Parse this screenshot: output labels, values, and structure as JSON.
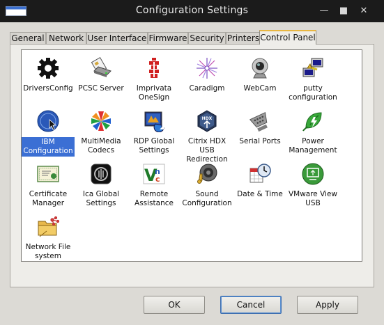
{
  "window": {
    "title": "Configuration Settings"
  },
  "tabs": [
    "General",
    "Network",
    "User Interface",
    "Firmware",
    "Security",
    "Printers",
    "Control Panel"
  ],
  "active_tab": "Control Panel",
  "items": [
    {
      "label": "DriversConfig",
      "icon": "gear-icon"
    },
    {
      "label": "PCSC Server",
      "icon": "card-reader-icon"
    },
    {
      "label": "Imprivata OneSign",
      "icon": "imprivata-icon"
    },
    {
      "label": "Caradigm",
      "icon": "caradigm-icon"
    },
    {
      "label": "WebCam",
      "icon": "webcam-icon"
    },
    {
      "label": "putty configuration",
      "icon": "putty-icon"
    },
    {
      "label": "IBM Configuration",
      "icon": "ibm-icon",
      "selected": true
    },
    {
      "label": "MultiMedia Codecs",
      "icon": "multimedia-icon"
    },
    {
      "label": "RDP Global Settings",
      "icon": "rdp-icon"
    },
    {
      "label": "Citrix HDX USB Redirection",
      "icon": "citrix-hdx-icon"
    },
    {
      "label": "Serial Ports",
      "icon": "serial-port-icon"
    },
    {
      "label": "Power Management",
      "icon": "power-icon"
    },
    {
      "label": "Certificate Manager",
      "icon": "certificate-icon"
    },
    {
      "label": "Ica Global Settings",
      "icon": "ica-icon"
    },
    {
      "label": "Remote Assistance",
      "icon": "vnc-icon"
    },
    {
      "label": "Sound Configuration",
      "icon": "speaker-icon"
    },
    {
      "label": "Date & Time",
      "icon": "clock-icon"
    },
    {
      "label": "VMware View USB",
      "icon": "vmware-icon"
    },
    {
      "label": "Network File system",
      "icon": "network-folder-icon"
    }
  ],
  "buttons": {
    "ok": "OK",
    "cancel": "Cancel",
    "apply": "Apply"
  },
  "colors": {
    "titlebar": "#1b1b1b",
    "selection": "#3b6fd4",
    "active_tab_accent": "#e8b640"
  }
}
